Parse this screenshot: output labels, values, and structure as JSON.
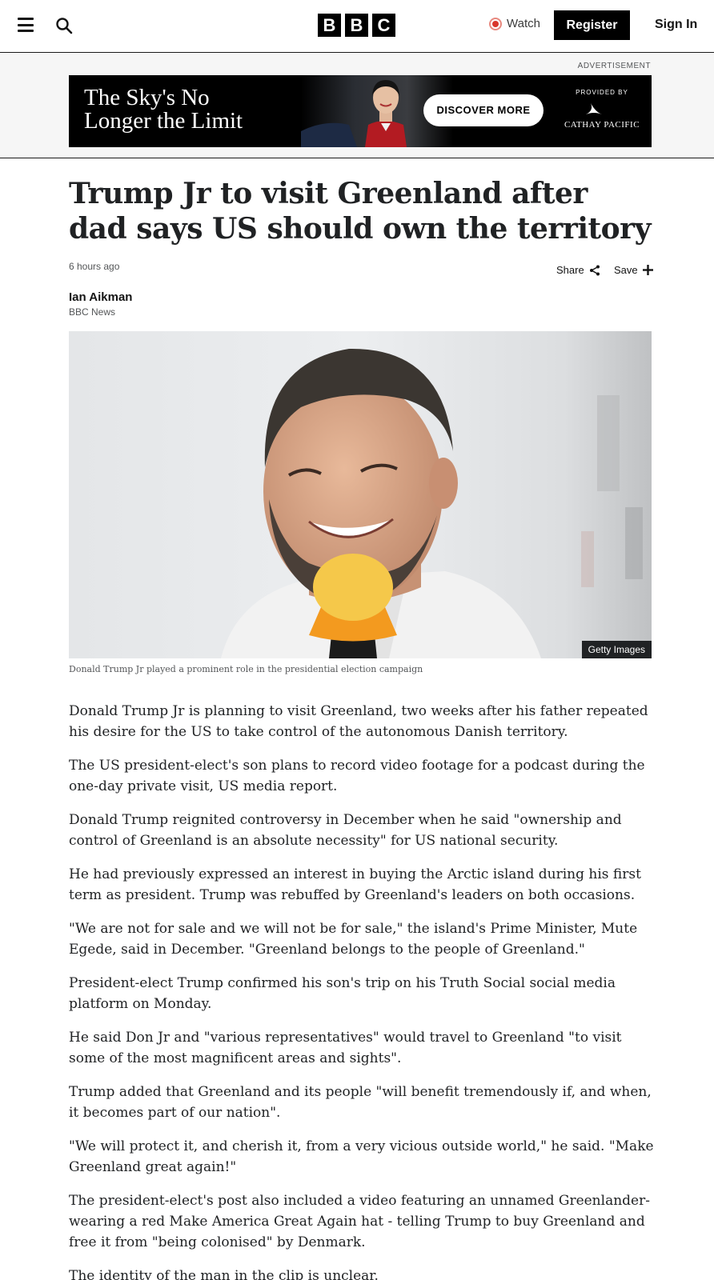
{
  "header": {
    "logo_letters": [
      "B",
      "B",
      "C"
    ],
    "watch_label": "Watch",
    "register_label": "Register",
    "signin_label": "Sign In",
    "icons": [
      "menu-icon",
      "search-icon",
      "live-dot-icon"
    ]
  },
  "ad": {
    "label": "ADVERTISEMENT",
    "headline": "The Sky's No Longer the Limit",
    "cta": "DISCOVER MORE",
    "provided_by": "PROVIDED BY",
    "brand": "CATHAY PACIFIC"
  },
  "article": {
    "headline": "Trump Jr to visit Greenland after dad says US should own the territory",
    "timestamp": "6 hours ago",
    "share_label": "Share",
    "save_label": "Save",
    "author": "Ian Aikman",
    "author_org": "BBC News",
    "image_credit": "Getty Images",
    "image_caption": "Donald Trump Jr played a prominent role in the presidential election campaign",
    "paragraphs": [
      "Donald Trump Jr is planning to visit Greenland, two weeks after his father repeated his desire for the US to take control of the autonomous Danish territory.",
      "The US president-elect's son plans to record video footage for a podcast during the one-day private visit, US media report.",
      "Donald Trump reignited controversy in December when he said \"ownership and control of Greenland is an absolute necessity\" for US national security.",
      "He had previously expressed an interest in buying the Arctic island during his first term as president. Trump was rebuffed by Greenland's leaders on both occasions.",
      "\"We are not for sale and we will not be for sale,\" the island's Prime Minister, Mute Egede, said in December. \"Greenland belongs to the people of Greenland.\"",
      "President-elect Trump confirmed his son's trip on his Truth Social social media platform on Monday.",
      "He said Don Jr and \"various representatives\" would travel to Greenland \"to visit some of the most magnificent areas and sights\".",
      "Trump added that Greenland and its people \"will benefit tremendously if, and when, it becomes part of our nation\".",
      "\"We will protect it, and cherish it, from a very vicious outside world,\" he said. \"Make Greenland great again!\"",
      "The president-elect's post also included a video featuring an unnamed Greenlander- wearing a red Make America Great Again hat - telling Trump to buy Greenland and free it from \"being colonised\" by Denmark.",
      "The identity of the man in the clip is unclear."
    ]
  },
  "colors": {
    "text": "#202224",
    "meta": "#545658",
    "live_red": "#d9362b",
    "ad_bg": "#000000",
    "band_bg": "#f6f6f6"
  }
}
